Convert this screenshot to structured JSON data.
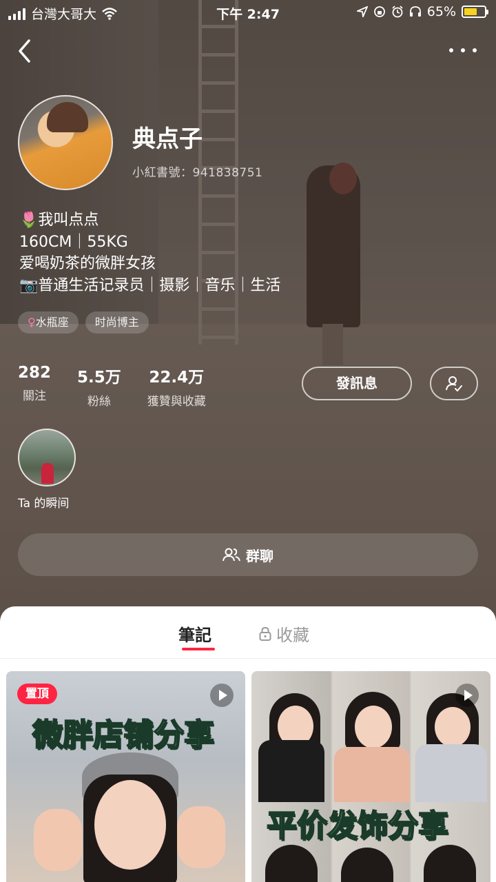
{
  "status_bar": {
    "carrier": "台灣大哥大",
    "time": "下午 2:47",
    "battery": "65%",
    "battery_level": 0.65
  },
  "profile": {
    "name": "典点子",
    "red_id": "小紅書號：941838751",
    "bio": [
      "🌷我叫点点",
      "160CM｜55KG",
      "爱喝奶茶的微胖女孩",
      "📷普通生活记录员｜摄影｜音乐｜生活"
    ],
    "tags": [
      {
        "symbol": "♀",
        "label": "水瓶座"
      },
      {
        "label": "时尚博主"
      }
    ]
  },
  "stats": [
    {
      "value": "282",
      "label": "關注"
    },
    {
      "value": "5.5万",
      "label": "粉絲"
    },
    {
      "value": "22.4万",
      "label": "獲贊與收藏"
    }
  ],
  "actions": {
    "message": "發訊息",
    "group_chat": "群聊"
  },
  "moments": {
    "label": "Ta 的瞬间"
  },
  "tabs": {
    "notes": "筆記",
    "favorites": "收藏"
  },
  "posts": [
    {
      "badge": "置頂",
      "title": "微胖店铺分享",
      "video": true
    },
    {
      "title": "平价发饰分享",
      "video": true
    }
  ],
  "icons": [
    "back-icon",
    "more-icon",
    "follow-check-icon",
    "group-icon",
    "lock-icon",
    "play-icon",
    "wifi-icon",
    "location-icon",
    "alarm-icon",
    "headphones-icon"
  ]
}
